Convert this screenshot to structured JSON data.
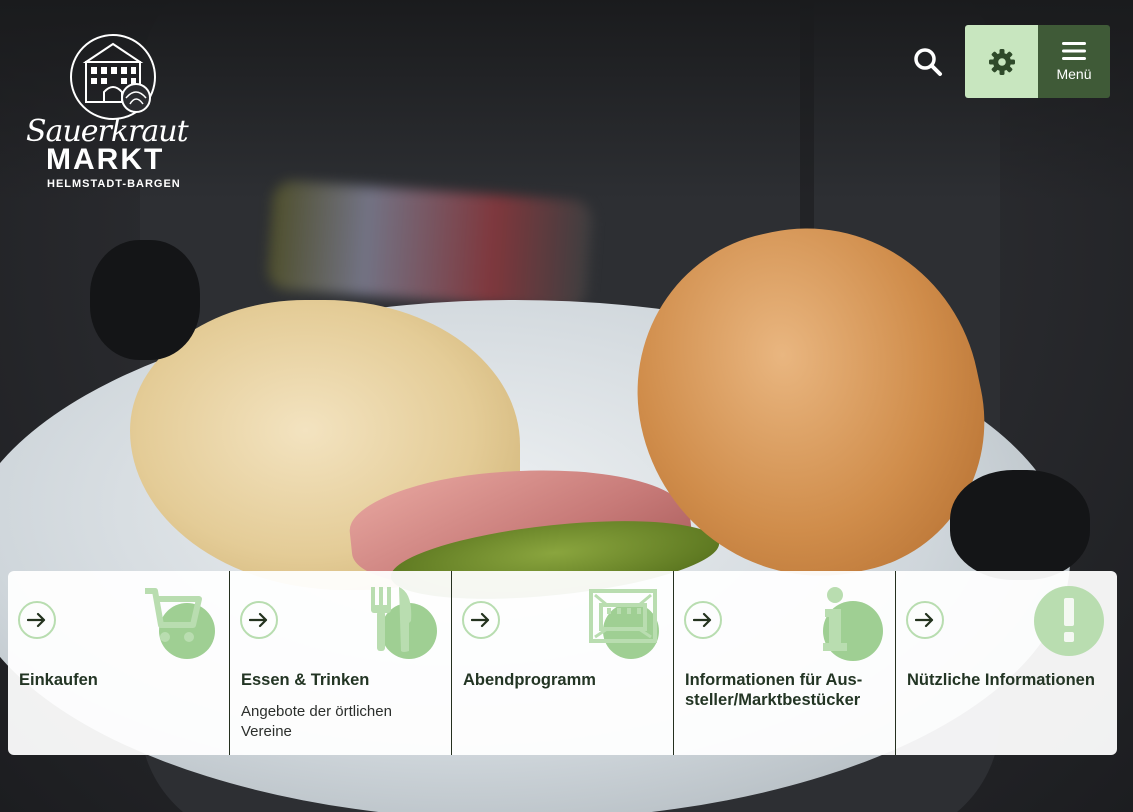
{
  "logo": {
    "script_text": "Sauerkraut",
    "word_text": "MARKT",
    "subline": "HELMSTADT-BARGEN"
  },
  "header": {
    "search_icon": "search-icon",
    "settings_icon": "gear-icon",
    "menu_icon": "hamburger-icon",
    "menu_label": "Menü"
  },
  "colors": {
    "accent_light": "#c8e6bf",
    "accent_dark": "#3f5a37",
    "icon_green": "#9fcf93"
  },
  "quicklinks": [
    {
      "title": "Einkaufen",
      "description": "",
      "icon": "shopping-cart-icon"
    },
    {
      "title": "Essen & Trinken",
      "description": "Angebote der örtlichen Vereine",
      "icon": "fork-knife-icon"
    },
    {
      "title": "Abendprogramm",
      "description": "",
      "icon": "stage-icon"
    },
    {
      "title": "Informationen für Aus-steller/Marktbestücker",
      "description": "",
      "icon": "info-icon"
    },
    {
      "title": "Nützliche Informationen",
      "description": "",
      "icon": "exclamation-icon"
    }
  ]
}
